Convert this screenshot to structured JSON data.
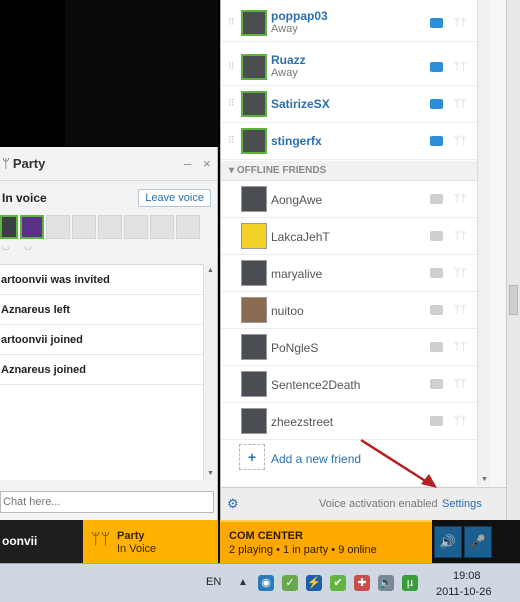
{
  "party": {
    "title": "Party",
    "voice_label": "In voice",
    "leave_button": "Leave voice",
    "events": [
      "artoonvii was invited",
      "Aznareus left",
      "artoonvii joined",
      "Aznareus joined"
    ],
    "chat_placeholder": "Chat here..."
  },
  "friends": {
    "online": [
      {
        "name": "poppap03",
        "status": "Away"
      },
      {
        "name": "Ruazz",
        "status": "Away"
      },
      {
        "name": "SatirizeSX",
        "status": ""
      },
      {
        "name": "stingerfx",
        "status": ""
      }
    ],
    "offline_header": "OFFLINE FRIENDS",
    "offline": [
      "AongAwe",
      "LakcaJehT",
      "maryalive",
      "nuitoo",
      "PoNgleS",
      "Sentence2Death",
      "zheezstreet"
    ],
    "add_friend": "Add a new friend",
    "voice_activation": "Voice activation enabled",
    "settings": "Settings"
  },
  "bottom_bar": {
    "user": "oonvii",
    "party_title": "Party",
    "party_status": "In Voice",
    "com_title": "COM CENTER",
    "com_status": "2 playing • 1 in party • 9 online"
  },
  "taskbar": {
    "lang": "EN",
    "time": "19:08",
    "date": "2011-10-26"
  }
}
